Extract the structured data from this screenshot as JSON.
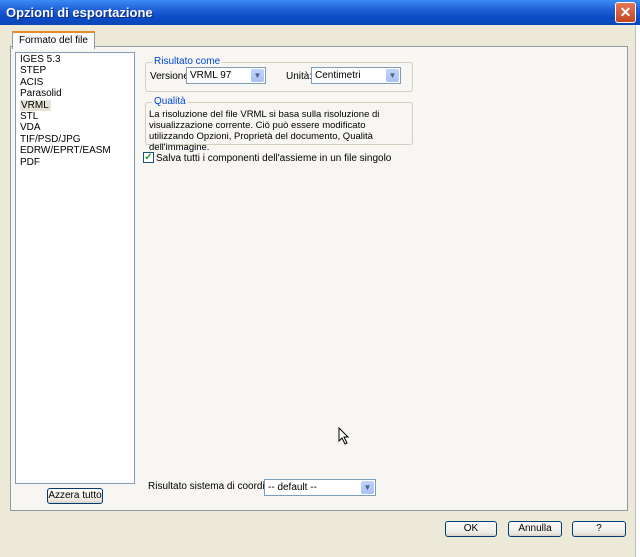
{
  "window": {
    "title": "Opzioni di esportazione"
  },
  "tab": {
    "label": "Formato del file"
  },
  "formats": {
    "items": [
      "IGES 5.3",
      "STEP",
      "ACIS",
      "Parasolid",
      "VRML",
      "STL",
      "VDA",
      "TIF/PSD/JPG",
      "EDRW/EPRT/EASM",
      "PDF"
    ],
    "selected": "VRML"
  },
  "reset_button": {
    "label": "Azzera tutto"
  },
  "output_group": {
    "title": "Risultato come",
    "version_label": "Versione:",
    "version_value": "VRML 97",
    "unit_label": "Unità:",
    "unit_value": "Centimetri"
  },
  "quality_group": {
    "title": "Qualità",
    "description": "La risoluzione del file VRML si basa sulla risoluzione di visualizzazione corrente. Ciò può essere modificato utilizzando Opzioni, Proprietà del documento, Qualità dell'immagine."
  },
  "assembly_checkbox": {
    "label": "Salva tutti i componenti dell'assieme in un file singolo",
    "checked": true
  },
  "coord_system": {
    "label": "Risultato sistema di coordinate:",
    "value": "-- default --"
  },
  "footer": {
    "ok": "OK",
    "cancel": "Annulla",
    "help": "?"
  }
}
